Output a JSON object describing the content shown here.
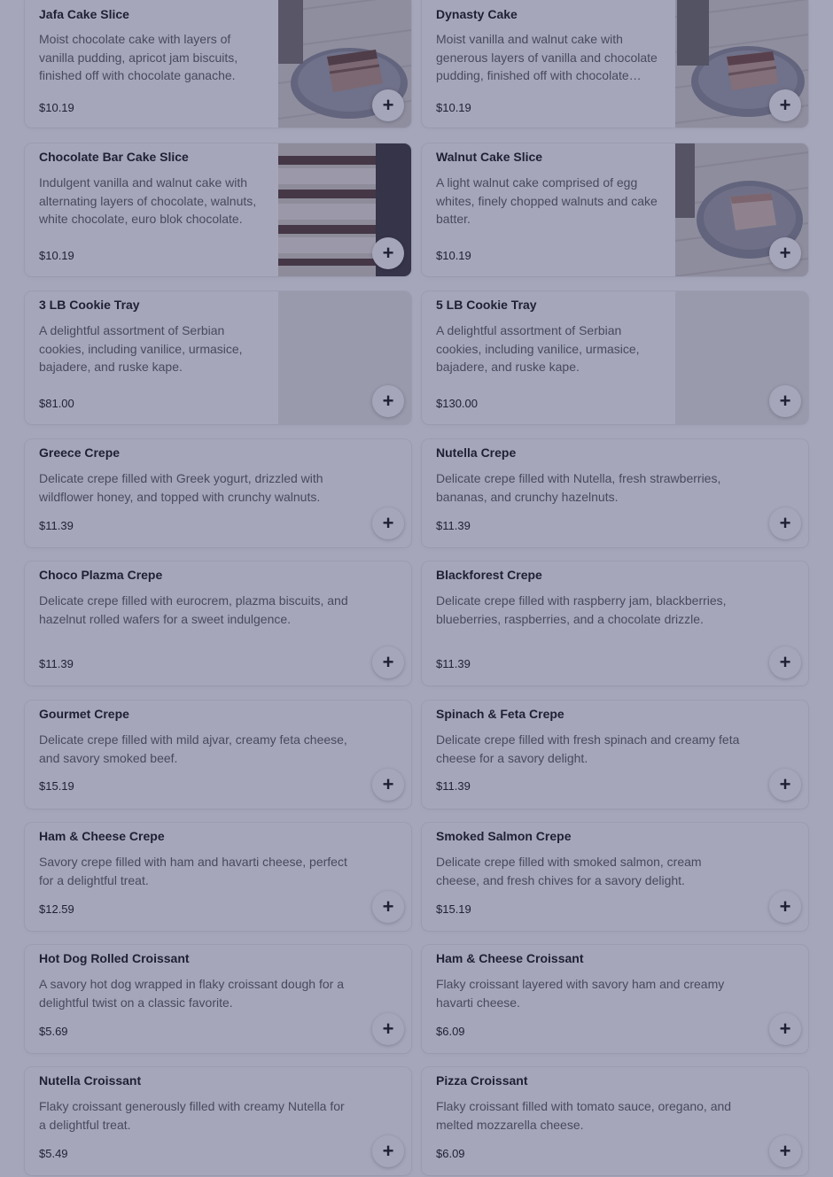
{
  "items": [
    {
      "title": "Jafa Cake Slice",
      "desc": "Moist chocolate cake with layers of vanilla pudding, apricot jam biscuits, finished off with chocolate ganache.",
      "price": "$10.19",
      "photo": "cake-slice-on-plate"
    },
    {
      "title": "Dynasty Cake",
      "desc": "Moist vanilla and walnut cake with generous layers of vanilla and chocolate pudding, finished off with chocolate ganache.",
      "price": "$10.19",
      "photo": "cake-slice-on-plate"
    },
    {
      "title": "Chocolate Bar Cake Slice",
      "desc": "Indulgent vanilla and walnut cake with alternating layers of chocolate, walnuts, white chocolate, euro blok chocolate.",
      "price": "$10.19",
      "photo": "layered-cake-closeup"
    },
    {
      "title": "Walnut Cake Slice",
      "desc": "A light walnut cake comprised of egg whites, finely chopped walnuts and cake batter.",
      "price": "$10.19",
      "photo": "cake-slice-on-plate"
    },
    {
      "title": "3 LB Cookie Tray",
      "desc": "A delightful assortment of Serbian cookies, including vanilice, urmasice, bajadere, and ruske kape.",
      "price": "$81.00",
      "photo": "placeholder"
    },
    {
      "title": "5 LB Cookie Tray",
      "desc": "A delightful assortment of Serbian cookies, including vanilice, urmasice, bajadere, and ruske kape.",
      "price": "$130.00",
      "photo": "placeholder"
    },
    {
      "title": "Greece Crepe",
      "desc": "Delicate crepe filled with Greek yogurt, drizzled with wildflower honey, and topped with crunchy walnuts.",
      "price": "$11.39"
    },
    {
      "title": "Nutella Crepe",
      "desc": "Delicate crepe filled with Nutella, fresh strawberries, bananas, and crunchy hazelnuts.",
      "price": "$11.39"
    },
    {
      "title": "Choco Plazma Crepe",
      "desc": "Delicate crepe filled with eurocrem, plazma biscuits, and hazelnut rolled wafers for a sweet indulgence.",
      "price": "$11.39"
    },
    {
      "title": "Blackforest Crepe",
      "desc": "Delicate crepe filled with raspberry jam, blackberries, blueberries, raspberries, and a chocolate drizzle.",
      "price": "$11.39"
    },
    {
      "title": "Gourmet Crepe",
      "desc": "Delicate crepe filled with mild ajvar, creamy feta cheese, and savory smoked beef.",
      "price": "$15.19"
    },
    {
      "title": "Spinach & Feta Crepe",
      "desc": "Delicate crepe filled with fresh spinach and creamy feta cheese for a savory delight.",
      "price": "$11.39"
    },
    {
      "title": "Ham & Cheese Crepe",
      "desc": "Savory crepe filled with ham and havarti cheese, perfect for a delightful treat.",
      "price": "$12.59"
    },
    {
      "title": "Smoked Salmon Crepe",
      "desc": "Delicate crepe filled with smoked salmon, cream cheese, and fresh chives for a savory delight.",
      "price": "$15.19"
    },
    {
      "title": "Hot Dog Rolled Croissant",
      "desc": "A savory hot dog wrapped in flaky croissant dough for a delightful twist on a classic favorite.",
      "price": "$5.69"
    },
    {
      "title": "Ham & Cheese Croissant",
      "desc": "Flaky croissant layered with savory ham and creamy havarti cheese.",
      "price": "$6.09"
    },
    {
      "title": "Nutella Croissant",
      "desc": "Flaky croissant generously filled with creamy Nutella for a delightful treat.",
      "price": "$5.49"
    },
    {
      "title": "Pizza Croissant",
      "desc": "Flaky croissant filled with tomato sauce, oregano, and melted mozzarella cheese.",
      "price": "$6.09"
    }
  ],
  "add_icon": "plus-icon",
  "colors": {
    "overlay": "#282c5a",
    "text": "#191919",
    "muted": "#606060"
  }
}
